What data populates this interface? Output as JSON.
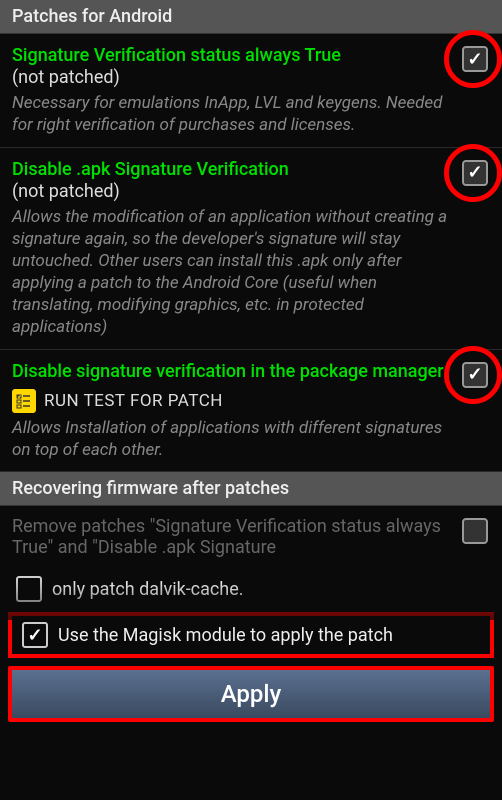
{
  "sections": {
    "patches_header": "Patches for Android",
    "recovery_header": "Recovering firmware after patches"
  },
  "patches": [
    {
      "title": "Signature Verification status always True",
      "status": "(not patched)",
      "desc": "Necessary for emulations InApp, LVL and keygens. Needed for right verification of purchases and licenses.",
      "checked": true,
      "highlighted": true
    },
    {
      "title": "Disable .apk Signature Verification",
      "status": "(not patched)",
      "desc": "Allows the modification of an application without creating a signature again, so the developer's signature will stay untouched. Other users can install this .apk only after applying a patch to the Android Core (useful when translating, modifying graphics, etc. in protected applications)",
      "checked": true,
      "highlighted": true
    },
    {
      "title": "Disable signature verification in the package manager",
      "status": "",
      "test_label": "RUN TEST FOR PATCH",
      "desc": "Allows Installation of applications with different signatures on top of each other.",
      "checked": true,
      "highlighted": true
    }
  ],
  "recovery": {
    "remove_title": "Remove patches \"Signature Verification status always True\" and \"Disable .apk Signature",
    "remove_checked": false
  },
  "options": {
    "dalvik_label": "only patch dalvik-cache.",
    "dalvik_checked": false,
    "magisk_label": "Use the Magisk module to apply the patch",
    "magisk_checked": true
  },
  "apply_label": "Apply"
}
